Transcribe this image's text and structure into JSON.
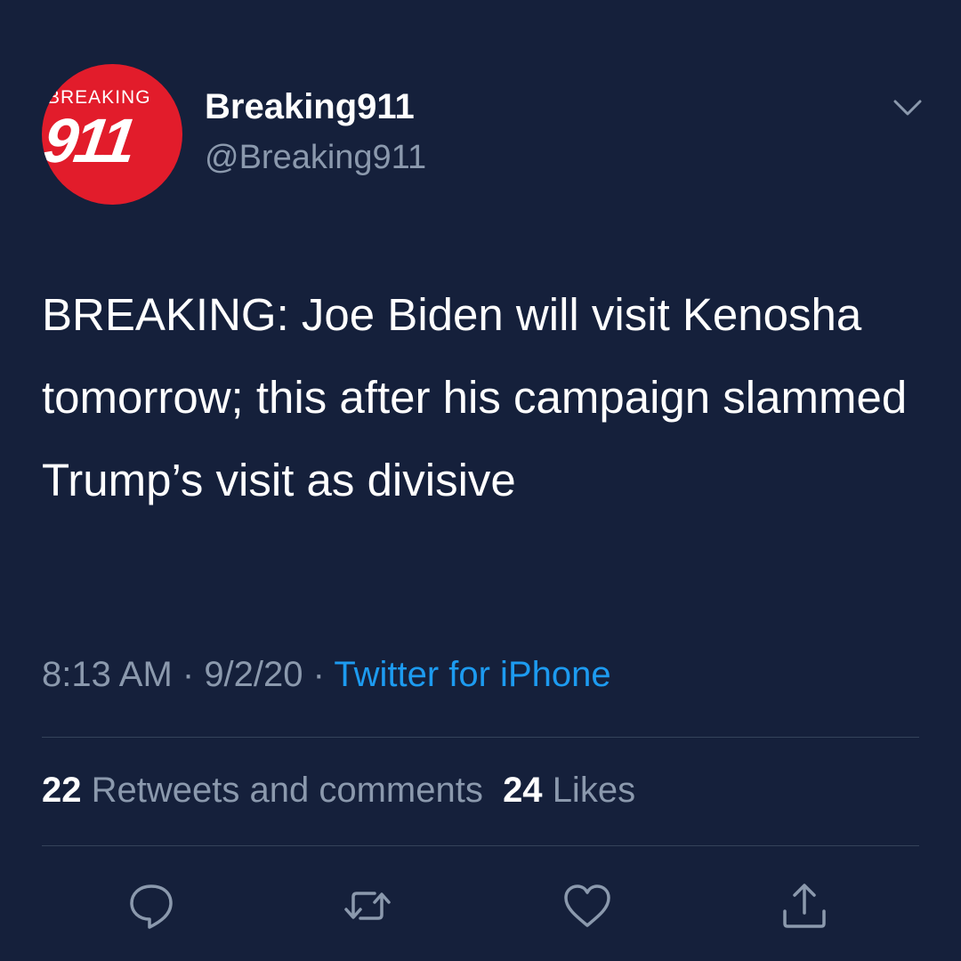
{
  "avatar": {
    "logo_top": "BREAKING",
    "logo_number": "911",
    "bg_color": "#e21c2b"
  },
  "user": {
    "display_name": "Breaking911",
    "handle": "@Breaking911"
  },
  "tweet": {
    "text": "BREAKING: Joe Biden will visit Kenosha tomorrow; this after his campaign slammed Trump’s visit as divisive"
  },
  "meta": {
    "time": "8:13 AM",
    "sep1": " · ",
    "date": "9/2/20",
    "sep2": " · ",
    "source": "Twitter for iPhone"
  },
  "stats": {
    "retweets_count": "22",
    "retweets_label": "Retweets and comments",
    "likes_count": "24",
    "likes_label": "Likes"
  },
  "icons": {
    "more": "chevron-down-icon",
    "reply": "reply-icon",
    "retweet": "retweet-icon",
    "like": "heart-icon",
    "share": "share-icon"
  },
  "colors": {
    "background": "#15203b",
    "secondary_text": "#8b99ad",
    "link": "#1d9bf0"
  }
}
